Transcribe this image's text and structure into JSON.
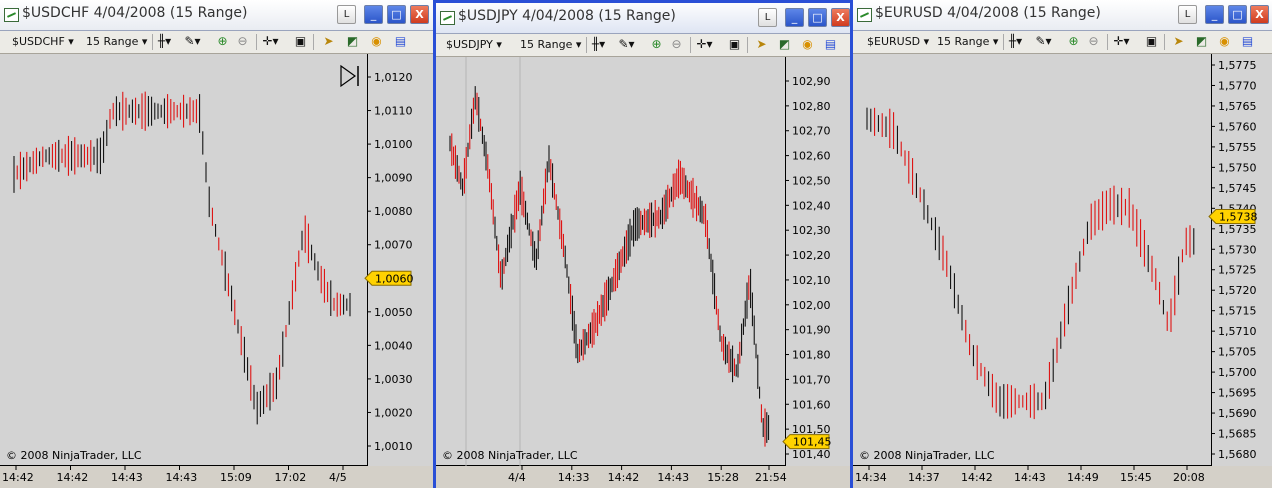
{
  "windows": [
    {
      "title": "$USDCHF  4/04/2008 (15 Range)",
      "symbol": "$USDCHF",
      "period": "15 Range",
      "copyright": "© 2008 NinjaTrader, LLC",
      "y_labels": [
        "1,0120",
        "1,0110",
        "1,0100",
        "1,0090",
        "1,0080",
        "1,0070",
        "1,0060",
        "1,0050",
        "1,0040",
        "1,0030",
        "1,0020",
        "1,0010"
      ],
      "x_labels": [
        "14:42",
        "14:42",
        "14:43",
        "14:43",
        "15:09",
        "17:02",
        "4/5"
      ],
      "last_price": "1,0060",
      "buttons": {
        "lock": "L",
        "minimize": "_",
        "maximize": "□",
        "close": "X"
      }
    },
    {
      "title": "$USDJPY  4/04/2008 (15 Range)",
      "symbol": "$USDJPY",
      "period": "15 Range",
      "copyright": "© 2008 NinjaTrader, LLC",
      "y_labels": [
        "102,90",
        "102,80",
        "102,70",
        "102,60",
        "102,50",
        "102,40",
        "102,30",
        "102,20",
        "102,10",
        "102,00",
        "101,90",
        "101,80",
        "101,70",
        "101,60",
        "101,50",
        "101,40"
      ],
      "x_labels": [
        "4/4",
        "14:33",
        "14:42",
        "14:43",
        "15:28",
        "21:54"
      ],
      "last_price": "101,45",
      "buttons": {
        "lock": "L",
        "minimize": "_",
        "maximize": "□",
        "close": "X"
      }
    },
    {
      "title": "$EURUSD  4/04/2008 (15 Range)",
      "symbol": "$EURUSD",
      "period": "15 Range",
      "copyright": "© 2008 NinjaTrader, LLC",
      "y_labels": [
        "1,5775",
        "1,5770",
        "1,5765",
        "1,5760",
        "1,5755",
        "1,5750",
        "1,5745",
        "1,5740",
        "1,5735",
        "1,5730",
        "1,5725",
        "1,5720",
        "1,5715",
        "1,5710",
        "1,5705",
        "1,5700",
        "1,5695",
        "1,5690",
        "1,5685",
        "1,5680"
      ],
      "x_labels": [
        "14:34",
        "14:37",
        "14:42",
        "14:43",
        "14:49",
        "15:45",
        "20:08"
      ],
      "last_price": "1,5738",
      "buttons": {
        "lock": "L",
        "minimize": "_",
        "maximize": "□",
        "close": "X"
      }
    }
  ],
  "toolbar_icons": [
    "bar-type-icon",
    "draw-pencil-icon",
    "zoom-in-icon",
    "zoom-out-icon",
    "crosshair-icon",
    "data-box-icon",
    "strategy-icon",
    "indicator-icon",
    "market-analyzer-icon",
    "properties-icon"
  ],
  "colors": {
    "up_bar": "#000000",
    "down_bar": "#e00000",
    "chart_bg": "#d3d3d3",
    "active_border": "#2a4fd6",
    "price_marker": "#ffd200"
  }
}
